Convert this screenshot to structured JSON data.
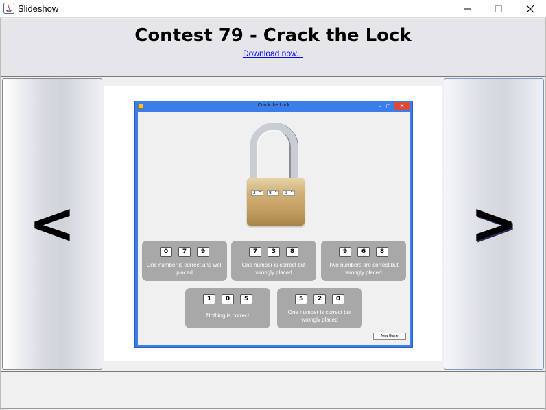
{
  "window": {
    "title": "Slideshow",
    "controls": {
      "minimize": "—",
      "maximize": "☐",
      "close": "✕"
    }
  },
  "header": {
    "title": "Contest 79 - Crack the Lock",
    "download_link": "Download now..."
  },
  "nav": {
    "prev_label": "<",
    "next_label": ">"
  },
  "slide": {
    "inner_window_title": "Crack the Lock",
    "inner_controls": {
      "minimize": "–",
      "maximize": "□",
      "close": "✕"
    },
    "lock_dials": [
      "2",
      "8",
      "9"
    ],
    "clues": [
      {
        "digits": [
          "0",
          "7",
          "9"
        ],
        "text": "One number is correct and well placed"
      },
      {
        "digits": [
          "7",
          "3",
          "8"
        ],
        "text": "One number is correct but wrongly placed"
      },
      {
        "digits": [
          "9",
          "6",
          "8"
        ],
        "text": "Two numbers are correct but wrongly placed"
      },
      {
        "digits": [
          "1",
          "0",
          "5"
        ],
        "text": "Nothing is correct"
      },
      {
        "digits": [
          "5",
          "2",
          "0"
        ],
        "text": "One number is correct but wrongly placed"
      }
    ],
    "new_game_label": "New Game"
  },
  "colors": {
    "inner_titlebar": "#3b7de9",
    "card_bg": "#a8a8a8",
    "close_red": "#d94a3a",
    "link_blue": "#0000ee"
  }
}
